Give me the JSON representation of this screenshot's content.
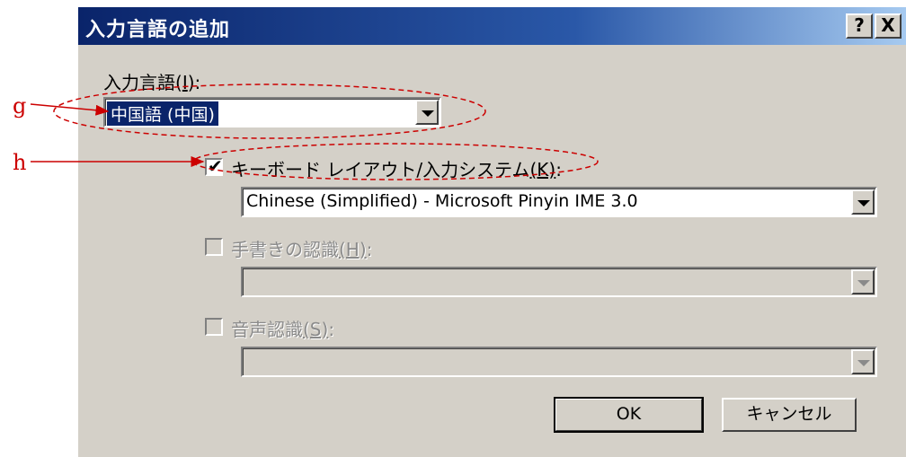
{
  "window": {
    "title": "入力言語の追加",
    "help_btn": "?",
    "close_btn": "X"
  },
  "input_language": {
    "label_main": "入力言語",
    "label_key": "I",
    "label_suffix": ":",
    "selected": "中国語 (中国)"
  },
  "keyboard_layout": {
    "checked": true,
    "check_glyph": "✔",
    "label_main": "キーボード レイアウト/入力システム",
    "label_key": "(K)",
    "label_suffix": ":",
    "value": "Chinese (Simplified) - Microsoft Pinyin IME 3.0"
  },
  "handwriting": {
    "checked": false,
    "label_main": "手書きの認識",
    "label_key": "(H)",
    "label_suffix": ":",
    "value": ""
  },
  "speech": {
    "checked": false,
    "label_main": "音声認識",
    "label_key": "(S)",
    "label_suffix": ":",
    "value": ""
  },
  "buttons": {
    "ok": "OK",
    "cancel": "キャンセル"
  },
  "annotations": {
    "g": "g",
    "h": "h",
    "color": "#cc0000"
  }
}
